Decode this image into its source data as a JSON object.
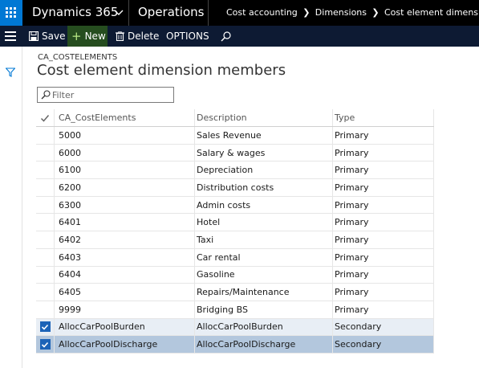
{
  "topbar": {
    "brand": "Dynamics 365",
    "app_name": "Operations",
    "breadcrumbs": [
      "Cost accounting",
      "Dimensions",
      "Cost element dimensions"
    ]
  },
  "actions": {
    "save": "Save",
    "new": "New",
    "delete": "Delete",
    "options": "OPTIONS"
  },
  "page": {
    "entity": "CA_COSTELEMENTS",
    "title": "Cost element dimension members",
    "filter_placeholder": "Filter"
  },
  "grid": {
    "columns": [
      "CA_CostElements",
      "Description",
      "Type"
    ],
    "rows": [
      {
        "code": "5000",
        "description": "Sales Revenue",
        "type": "Primary",
        "checked": false
      },
      {
        "code": "6000",
        "description": "Salary & wages",
        "type": "Primary",
        "checked": false
      },
      {
        "code": "6100",
        "description": "Depreciation",
        "type": "Primary",
        "checked": false
      },
      {
        "code": "6200",
        "description": "Distribution costs",
        "type": "Primary",
        "checked": false
      },
      {
        "code": "6300",
        "description": "Admin costs",
        "type": "Primary",
        "checked": false
      },
      {
        "code": "6401",
        "description": "Hotel",
        "type": "Primary",
        "checked": false
      },
      {
        "code": "6402",
        "description": "Taxi",
        "type": "Primary",
        "checked": false
      },
      {
        "code": "6403",
        "description": "Car rental",
        "type": "Primary",
        "checked": false
      },
      {
        "code": "6404",
        "description": "Gasoline",
        "type": "Primary",
        "checked": false
      },
      {
        "code": "6405",
        "description": "Repairs/Maintenance",
        "type": "Primary",
        "checked": false
      },
      {
        "code": "9999",
        "description": "Bridging BS",
        "type": "Primary",
        "checked": false
      },
      {
        "code": "AllocCarPoolBurden",
        "description": "AllocCarPoolBurden",
        "type": "Secondary",
        "checked": true
      },
      {
        "code": "AllocCarPoolDischarge",
        "description": "AllocCarPoolDischarge",
        "type": "Secondary",
        "checked": true,
        "selected": true
      }
    ]
  },
  "colors": {
    "topbar": "#000000",
    "waffle": "#0078d4",
    "actionbar": "#0d1a33",
    "new_button": "#264d1f",
    "selected_row": "#b3c7dd",
    "marked_row": "#e8eef5",
    "checkbox": "#1c63b7"
  },
  "icons": [
    "waffle-icon",
    "chevron-down-icon",
    "hamburger-icon",
    "save-icon",
    "plus-icon",
    "trash-icon",
    "search-icon",
    "filter-funnel-icon",
    "checkmark-icon"
  ]
}
